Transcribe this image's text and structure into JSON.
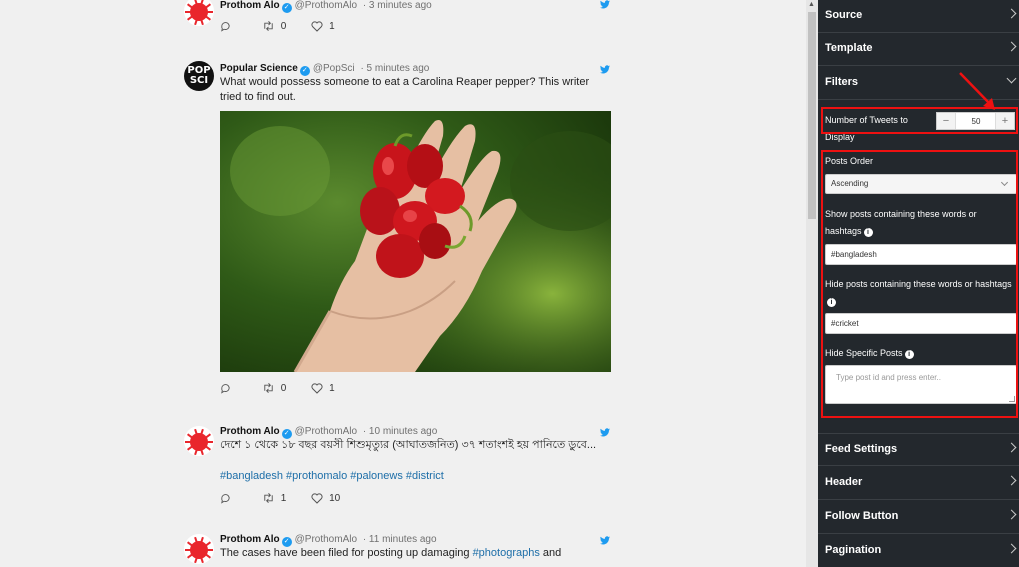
{
  "feed": {
    "tweets": [
      {
        "name": "Prothom Alo",
        "handle": "@ProthomAlo",
        "time": "· 3 minutes ago",
        "retweets": "0",
        "likes": "1"
      },
      {
        "name": "Popular Science",
        "handle": "@PopSci",
        "time": "· 5 minutes ago",
        "text": "What would possess someone to eat a Carolina Reaper pepper? This writer tried to find out.",
        "avatar_text_1": "POP",
        "avatar_text_2": "SCI",
        "retweets": "0",
        "likes": "1"
      },
      {
        "name": "Prothom Alo",
        "handle": "@ProthomAlo",
        "time": "· 10 minutes ago",
        "text": "দেশে ১ থেকে ১৮ বছর বয়সী শিশুমৃত্যুর (আঘাতজনিত) ৩৭ শতাংশই হয় পানিতে ডুবে...",
        "hashtags": "#bangladesh #prothomalo #palonews #district",
        "retweets": "1",
        "likes": "10"
      },
      {
        "name": "Prothom Alo",
        "handle": "@ProthomAlo",
        "time": "· 11 minutes ago",
        "text_before": "The cases have been filed for posting up damaging ",
        "text_link": "#photographs",
        "text_after": " and"
      }
    ]
  },
  "panel": {
    "sections_top": [
      {
        "label": "Source"
      },
      {
        "label": "Template"
      },
      {
        "label": "Filters"
      }
    ],
    "filters": {
      "num_tweets_label": "Number of Tweets to Display",
      "num_tweets_value": "50",
      "minus": "−",
      "plus": "+",
      "posts_order_label": "Posts Order",
      "posts_order_value": "Ascending",
      "show_label": "Show posts containing these words or hashtags",
      "show_value": "#bangladesh",
      "hide_label": "Hide posts containing these words or hashtags",
      "hide_value": "#cricket",
      "hide_specific_label": "Hide Specific Posts",
      "hide_specific_placeholder": "Type post id and press enter..",
      "info_glyph": "i"
    },
    "sections_bottom": [
      {
        "label": "Feed Settings"
      },
      {
        "label": "Header"
      },
      {
        "label": "Follow Button"
      },
      {
        "label": "Pagination"
      }
    ]
  },
  "colors": {
    "panel_bg": "#23282d",
    "highlight": "#e11111",
    "link": "#1d6ea8",
    "twitter_blue": "#1d9bf0"
  }
}
